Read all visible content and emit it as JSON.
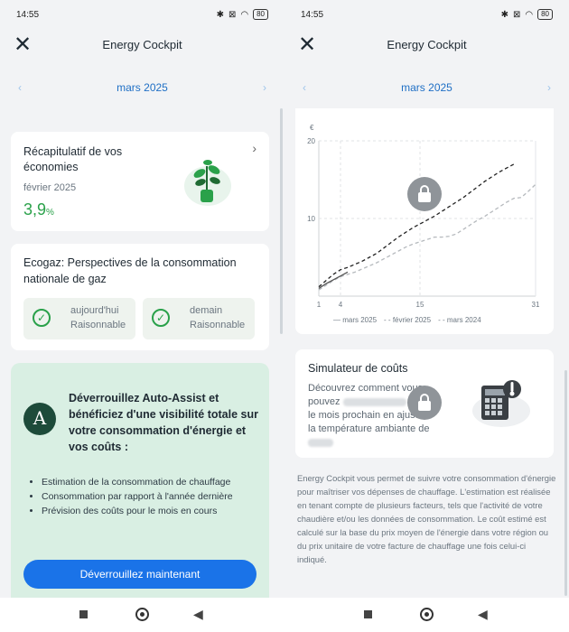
{
  "status_bar": {
    "time": "14:55",
    "battery": "80"
  },
  "header": {
    "title": "Energy Cockpit"
  },
  "month_nav": {
    "label": "mars 2025"
  },
  "savings": {
    "title": "Récapitulatif de vos économies",
    "period": "février 2025",
    "value": "3,9",
    "unit": "%"
  },
  "ecogaz": {
    "title": "Ecogaz: Perspectives de la consommation nationale de gaz",
    "today_label": "aujourd'hui",
    "today_status": "Raisonnable",
    "tomorrow_label": "demain",
    "tomorrow_status": "Raisonnable"
  },
  "promo": {
    "logo": "A",
    "headline": "Déverrouillez Auto-Assist et bénéficiez d'une visibilité totale sur votre consommation d'énergie et vos coûts :",
    "bullets": [
      "Estimation de la consommation de chauffage",
      "Consommation par rapport à l'année dernière",
      "Prévision des coûts pour le mois en cours"
    ],
    "button": "Déverrouillez maintenant"
  },
  "chart_data": {
    "type": "line",
    "ylabel": "€",
    "yticks": [
      20,
      10
    ],
    "xticks": [
      1,
      4,
      15,
      31
    ],
    "ylim": [
      0,
      20
    ],
    "xlim": [
      1,
      31
    ],
    "grid": true,
    "series": [
      {
        "name": "mars 2025",
        "style": "solid",
        "color": "#555555",
        "x": [
          1,
          2,
          3,
          4,
          5
        ],
        "y": [
          1.0,
          1.6,
          2.1,
          2.6,
          3.1
        ]
      },
      {
        "name": "février 2025",
        "style": "dashed",
        "color": "#222222",
        "x": [
          1,
          2,
          3,
          4,
          5,
          6,
          7,
          8,
          9,
          10,
          11,
          12,
          13,
          14,
          15,
          16,
          17,
          18,
          19,
          20,
          21,
          22,
          23,
          24,
          25,
          26,
          27,
          28
        ],
        "y": [
          1.2,
          2.0,
          2.8,
          3.4,
          3.7,
          4.1,
          4.5,
          5.0,
          5.5,
          6.2,
          6.9,
          7.6,
          8.2,
          8.8,
          9.3,
          9.8,
          10.3,
          10.9,
          11.5,
          12.1,
          12.7,
          13.4,
          14.1,
          14.8,
          15.4,
          16.0,
          16.5,
          17.0
        ]
      },
      {
        "name": "mars 2024",
        "style": "dashed",
        "color": "#b5b9bd",
        "x": [
          1,
          2,
          3,
          4,
          5,
          6,
          7,
          8,
          9,
          10,
          11,
          12,
          13,
          14,
          15,
          16,
          17,
          18,
          19,
          20,
          21,
          22,
          23,
          24,
          25,
          26,
          27,
          28,
          29,
          30,
          31
        ],
        "y": [
          0.8,
          1.4,
          2.0,
          2.5,
          2.8,
          3.1,
          3.5,
          3.9,
          4.3,
          4.8,
          5.3,
          5.8,
          6.3,
          6.7,
          7.0,
          7.3,
          7.6,
          7.6,
          7.7,
          8.0,
          8.6,
          9.2,
          9.8,
          10.3,
          10.9,
          11.5,
          12.1,
          12.6,
          12.7,
          13.5,
          14.4
        ]
      }
    ]
  },
  "simulator": {
    "title": "Simulateur de coûts",
    "line1": "Découvrez comment vous",
    "line2": "pouvez",
    "line3": "le mois prochain en ajustant",
    "line4": "la température ambiante de"
  },
  "info": {
    "text": "Energy Cockpit vous permet de suivre votre consommation d'énergie pour maîtriser vos dépenses de chauffage. L'estimation est réalisée en tenant compte de plusieurs facteurs, tels que l'activité de votre chaudière et/ou les données de consommation. Le coût estimé est calculé sur la base du prix moyen de l'énergie dans votre région ou du prix unitaire de votre facture de chauffage une fois celui-ci indiqué."
  }
}
